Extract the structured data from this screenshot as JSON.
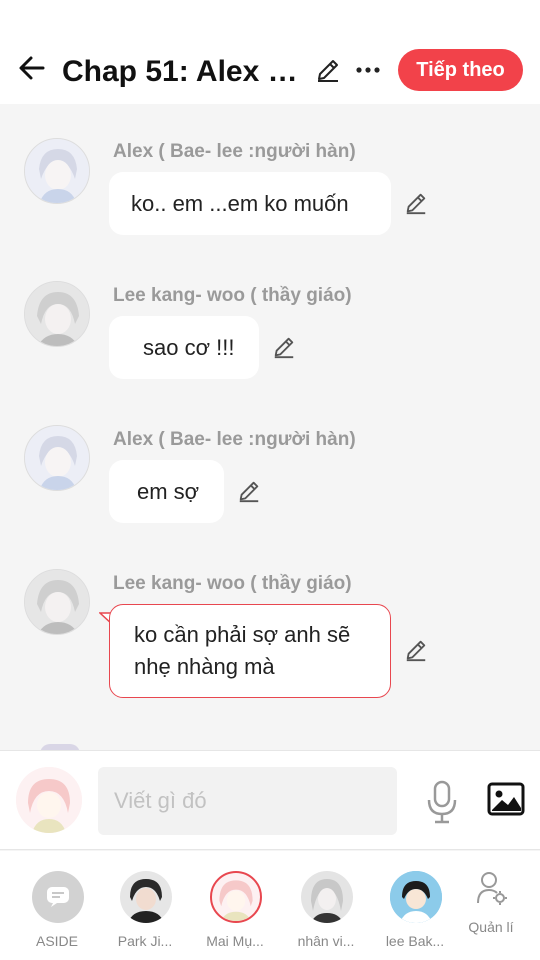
{
  "header": {
    "title": "Chap 51: Alex v...",
    "next_label": "Tiếp theo"
  },
  "messages": [
    {
      "sender": "Alex (  Bae- lee :người hàn)",
      "text": "ko.. em ...em ko muốn"
    },
    {
      "sender": "Lee kang- woo ( thầy giáo)",
      "text": "sao cơ !!!"
    },
    {
      "sender": "Alex (  Bae- lee :người hàn)",
      "text": "em sợ"
    },
    {
      "sender": "Lee kang- woo ( thầy giáo)",
      "text": "ko cần phải sợ anh sẽ nhẹ nhàng mà"
    }
  ],
  "composer": {
    "placeholder": "Viết gì đó"
  },
  "characters": [
    {
      "label": "ASIDE"
    },
    {
      "label": "Park Ji..."
    },
    {
      "label": "Mai Mụ..."
    },
    {
      "label": "nhân vi..."
    },
    {
      "label": "lee Bak..."
    }
  ],
  "manage_label": "Quản lí",
  "colors": {
    "accent": "#f2424a",
    "background": "#f5f5f5"
  },
  "icons": [
    "arrow-left-icon",
    "pencil-icon",
    "more-icon",
    "mic-icon",
    "image-icon",
    "user-gear-icon"
  ]
}
